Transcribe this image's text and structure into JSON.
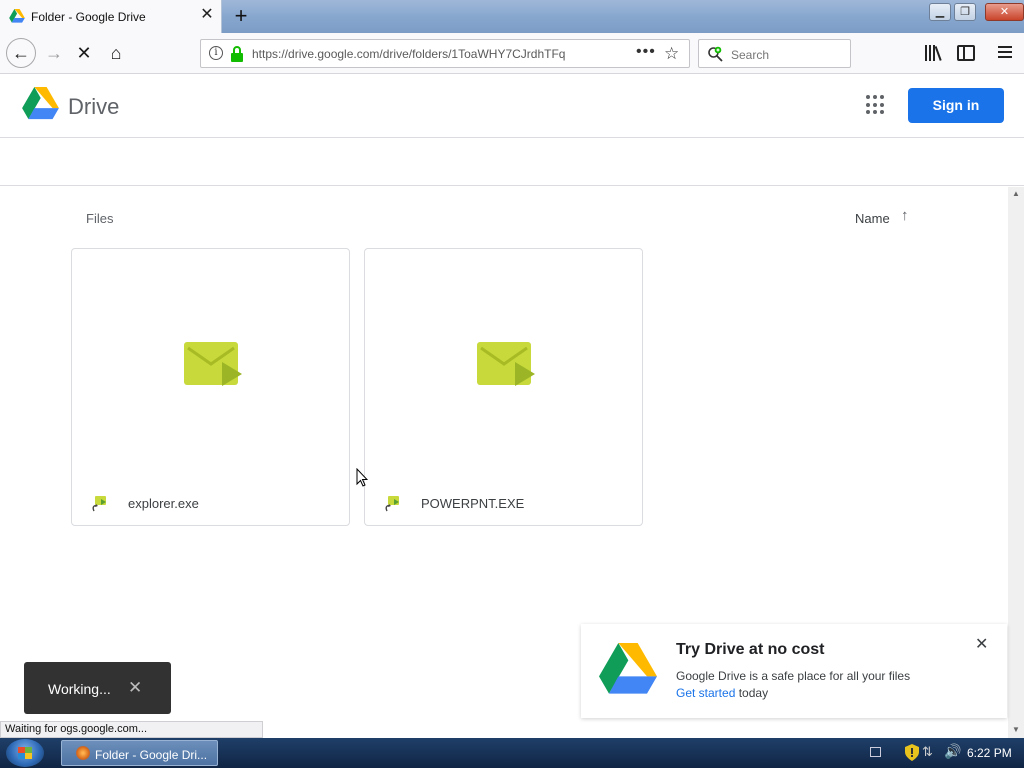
{
  "browser": {
    "tab_title": "Folder - Google Drive",
    "url": "https://drive.google.com/drive/folders/1ToaWHY7CJrdhTFq",
    "search_placeholder": "Search"
  },
  "drive": {
    "title": "Drive",
    "signin_label": "Sign in",
    "files_label": "Files",
    "sort_label": "Name",
    "files": [
      {
        "name": "explorer.exe"
      },
      {
        "name": "POWERPNT.EXE"
      }
    ]
  },
  "promo": {
    "title": "Try Drive at no cost",
    "text": "Google Drive is a safe place for all your files",
    "link": "Get started",
    "suffix": " today"
  },
  "snackbar": {
    "text": "Working..."
  },
  "status_text": "Waiting for ogs.google.com...",
  "taskbar": {
    "item_label": "Folder - Google Dri...",
    "clock": "6:22 PM"
  },
  "colors": {
    "accent": "#1a73e8",
    "file_thumb": "#c7d93b"
  },
  "icons": [
    "drive-logo-icon",
    "close-icon",
    "plus-icon",
    "back-icon",
    "forward-icon",
    "stop-icon",
    "home-icon",
    "info-icon",
    "lock-icon",
    "more-icon",
    "star-icon",
    "search-icon",
    "library-icon",
    "sidebar-icon",
    "menu-icon",
    "apps-icon",
    "sort-up-icon",
    "exe-file-icon",
    "chevron-up-icon",
    "chevron-down-icon",
    "windows-start-icon"
  ]
}
